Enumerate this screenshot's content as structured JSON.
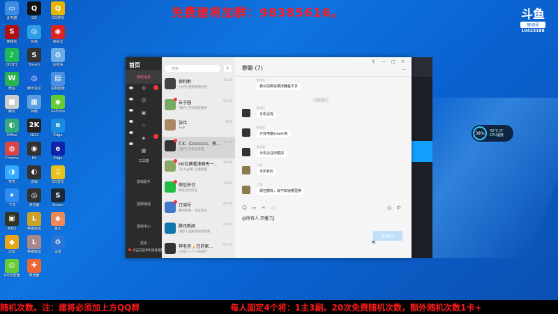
{
  "banner": {
    "top_text": "免费建将加群：98385616。",
    "bottom_left": "随机次数。注：建将必须加上方QQ群",
    "bottom_right": "每人固定4个将：1主3副。20次免费随机次数，额外随机次数1卡+"
  },
  "logo": {
    "mark": "斗鱼",
    "sub": "房间号",
    "room": "10423188"
  },
  "cpu": {
    "percent": "38%",
    "temp": "42°C 0°",
    "label": "CPU温度"
  },
  "desktop_icons": [
    {
      "label": "此电脑",
      "glyph": "▭",
      "color": "#3a8de0"
    },
    {
      "label": "QQ",
      "glyph": "Q",
      "color": "#111"
    },
    {
      "label": "QQ游戏",
      "glyph": "Q",
      "color": "#e7b400"
    },
    {
      "label": "英雄杀",
      "glyph": "S",
      "color": "#b01010"
    },
    {
      "label": "网易",
      "glyph": "◎",
      "color": "#2f9ce8"
    },
    {
      "label": "网易云",
      "glyph": "◉",
      "color": "#d22"
    },
    {
      "label": "QQ音乐",
      "glyph": "♪",
      "color": "#1db954"
    },
    {
      "label": "Steam",
      "glyph": "S",
      "color": "#333"
    },
    {
      "label": "回收站",
      "glyph": "♻",
      "color": "#6aaee8"
    },
    {
      "label": "微信",
      "glyph": "W",
      "color": "#29b34a"
    },
    {
      "label": "腾讯会议",
      "glyph": "◎",
      "color": "#1560d4"
    },
    {
      "label": "控制面板",
      "glyph": "▤",
      "color": "#4a90e2"
    },
    {
      "label": "腾讯",
      "glyph": "■",
      "color": "#ccc"
    },
    {
      "label": "网络",
      "glyph": "▦",
      "color": "#5b9fe0"
    },
    {
      "label": "GeForce",
      "glyph": "◆",
      "color": "#6c3"
    },
    {
      "label": "Office",
      "glyph": "◐",
      "color": "#3a7"
    },
    {
      "label": "2K22",
      "glyph": "2K",
      "color": "#222"
    },
    {
      "label": "Edge",
      "glyph": "e",
      "color": "#1a8de0"
    },
    {
      "label": "Chrome",
      "glyph": "◍",
      "color": "#d44"
    },
    {
      "label": "EA",
      "glyph": "◉",
      "color": "#333"
    },
    {
      "label": "Edge",
      "glyph": "e",
      "color": "#12a"
    },
    {
      "label": "夸克",
      "glyph": "◑",
      "color": "#3af"
    },
    {
      "label": "游戏",
      "glyph": "◐",
      "color": "#333"
    },
    {
      "label": "QQ音乐",
      "glyph": "♫",
      "color": "#e8c11a"
    },
    {
      "label": "飞书",
      "glyph": "✦",
      "color": "#2d8cf0"
    },
    {
      "label": "浏览器",
      "glyph": "◎",
      "color": "#333"
    },
    {
      "label": "Steam",
      "glyph": "S",
      "color": "#1b2838"
    },
    {
      "label": "游戏2",
      "glyph": "▣",
      "color": "#332"
    },
    {
      "label": "英雄联盟",
      "glyph": "L",
      "color": "#c9a227"
    },
    {
      "label": "金山",
      "glyph": "◆",
      "color": "#e85"
    },
    {
      "label": "迅雷",
      "glyph": "◆",
      "color": "#e6a417"
    },
    {
      "label": "英雄联盟",
      "glyph": "L",
      "color": "#a88"
    },
    {
      "label": "设置",
      "glyph": "⚙",
      "color": "#2a74d8"
    },
    {
      "label": "QQ浏览器",
      "glyph": "◎",
      "color": "#6c3"
    },
    {
      "label": "修改器",
      "glyph": "✚",
      "color": "#e63"
    }
  ],
  "qq": {
    "brand": "首页",
    "rail_labels": [
      "我的消息",
      "工具箱",
      "游戏助手",
      "视频通话",
      "游戏中心",
      "更多"
    ],
    "bottom_notice": "点击开启手机消息提醒功能",
    "search_placeholder": "搜索",
    "conversations": [
      {
        "name": "保利群",
        "preview": "[文件] 使用说明文档",
        "time": "10:35",
        "color": "#444",
        "dot": false
      },
      {
        "name": "亲子园",
        "preview": "[图片] 在吗欢迎来到",
        "time": "09:21",
        "color": "#7a6",
        "dot": true
      },
      {
        "name": "张伟",
        "preview": "😀😀",
        "time": "昨天",
        "color": "#a86",
        "dot": false
      },
      {
        "name": "T.X、Cccccccc、熊...",
        "preview": "[图片] 手机没有电",
        "time": "10:12",
        "color": "#333",
        "dot": true
      },
      {
        "name": "kkl比赛看谁聊天一...",
        "preview": "[有人@我] 让我看看",
        "time": "10:08",
        "color": "#8a6",
        "dot": true
      },
      {
        "name": "微信支付",
        "preview": "微信支付凭证",
        "time": "10:05",
        "color": "#2b4",
        "dot": true
      },
      {
        "name": "订阅号",
        "preview": "腾讯新闻：今日热点",
        "time": "09:40",
        "color": "#47c",
        "dot": true
      },
      {
        "name": "腾讯新闻",
        "preview": "[图片] 国家发布新政策",
        "time": "09:20",
        "color": "#17a",
        "dot": false
      },
      {
        "name": "神毛怪🍦往的家...",
        "preview": "[分享] 一个人的旅行",
        "time": "09:10",
        "color": "#333",
        "dot": false
      }
    ],
    "chat": {
      "title": "群聊 (7)",
      "timestamp": "10:33",
      "messages": [
        {
          "sender": "群成员",
          "text": "我以前那会模拟器差不多"
        },
        {
          "sender": "群成员",
          "text": "手机没有"
        },
        {
          "sender": "群成员",
          "text": "只有电脑steam有"
        },
        {
          "sender": "群成员",
          "text": "手机没任何模拟"
        },
        {
          "sender": "二哥",
          "text": "手机有的"
        },
        {
          "sender": "二哥",
          "text": "现在都有，就不知道哪里换"
        }
      ],
      "input": "@所有人 开播了",
      "send_label": "发送(S)"
    }
  }
}
